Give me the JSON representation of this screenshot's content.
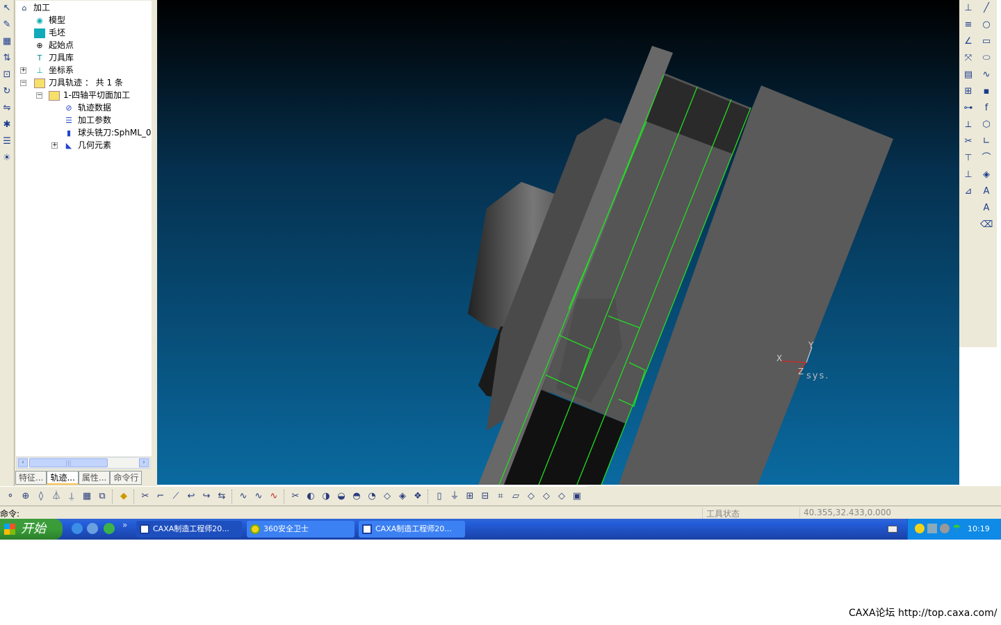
{
  "tree": {
    "root": "加工",
    "model": "模型",
    "blank": "毛坯",
    "start_point": "起始点",
    "tool_library": "刀具库",
    "coord_system": "坐标系",
    "toolpath": "刀具轨迹 ： 共 1 条",
    "op": "1-四轴平切面加工",
    "path_data": "轨迹数据",
    "params": "加工参数",
    "tool": "球头铣刀:SphML_0",
    "geometry": "几何元素"
  },
  "tabs": [
    "特征...",
    "轨迹...",
    "属性...",
    "命令行"
  ],
  "viewport": {
    "axis_x": "X",
    "axis_y": "Y",
    "axis_z": "Z",
    "axis_label": "sys."
  },
  "status": {
    "command_label": "命令:",
    "tool_state": "工具状态",
    "coords": "40.355,32.433,0.000"
  },
  "taskbar": {
    "start": "开始",
    "more": "»",
    "tasks": [
      "CAXA制造工程师20...",
      "360安全卫士",
      "CAXA制造工程师20..."
    ],
    "clock": "10:19"
  },
  "footer": "CAXA论坛 http://top.caxa.com/"
}
